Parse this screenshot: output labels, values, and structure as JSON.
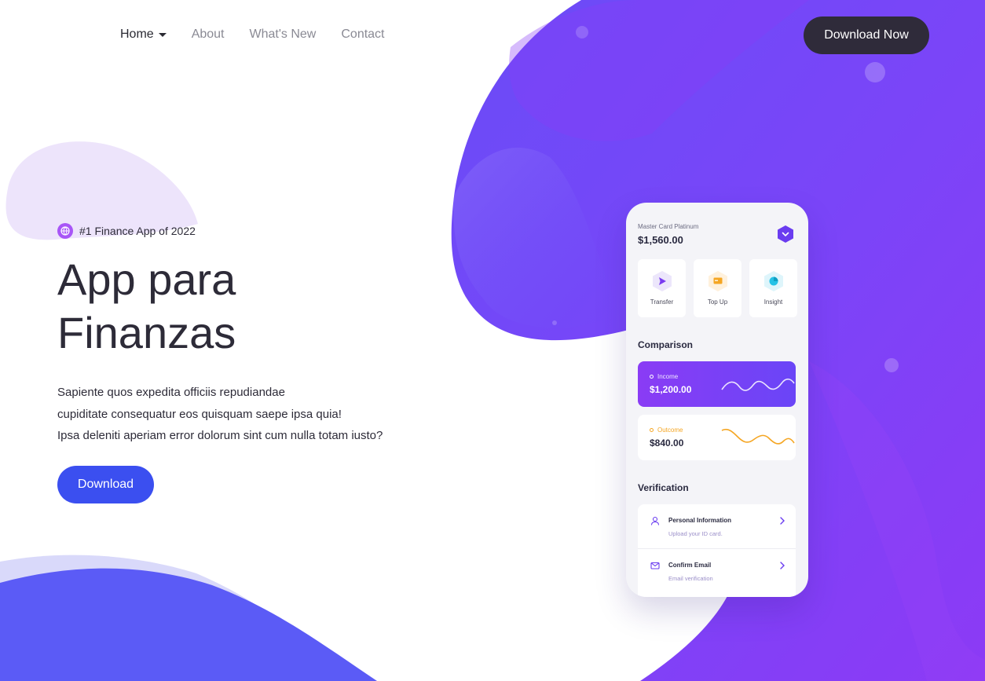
{
  "nav": {
    "items": [
      {
        "label": "Home",
        "active": true
      },
      {
        "label": "About",
        "active": false
      },
      {
        "label": "What's New",
        "active": false
      },
      {
        "label": "Contact",
        "active": false
      }
    ],
    "cta_label": "Download Now"
  },
  "hero": {
    "badge": "#1 Finance App of 2022",
    "title_line1": "App para",
    "title_line2": "Finanzas",
    "body_line1": "Sapiente quos expedita officiis repudiandae",
    "body_line2": "cupiditate consequatur eos quisquam saepe ipsa quia!",
    "body_line3": "Ipsa deleniti aperiam error dolorum sint cum nulla totam iusto?",
    "button_label": "Download"
  },
  "phone": {
    "card_label": "Master Card Platinum",
    "card_amount": "$1,560.00",
    "actions": [
      {
        "label": "Transfer",
        "icon": "send-icon",
        "tint": "#ece6fb",
        "color": "#7a3cf0"
      },
      {
        "label": "Top Up",
        "icon": "card-icon",
        "tint": "#fff1dc",
        "color": "#f5a623"
      },
      {
        "label": "Insight",
        "icon": "pie-chart-icon",
        "tint": "#def5fb",
        "color": "#24c2e6"
      }
    ],
    "comparison_title": "Comparison",
    "income": {
      "label": "Income",
      "amount": "$1,200.00"
    },
    "outcome": {
      "label": "Outcome",
      "amount": "$840.00"
    },
    "verification_title": "Verification",
    "verify_items": [
      {
        "title": "Personal Information",
        "subtitle": "Upload your ID card.",
        "icon": "user-icon"
      },
      {
        "title": "Confirm Email",
        "subtitle": "Email verification",
        "icon": "mail-icon"
      }
    ]
  },
  "colors": {
    "accent_purple": "#7a3cf5",
    "dark_button": "#2f2b3a",
    "primary_blue": "#3b4ff0",
    "income_orange": "#f5a623"
  }
}
